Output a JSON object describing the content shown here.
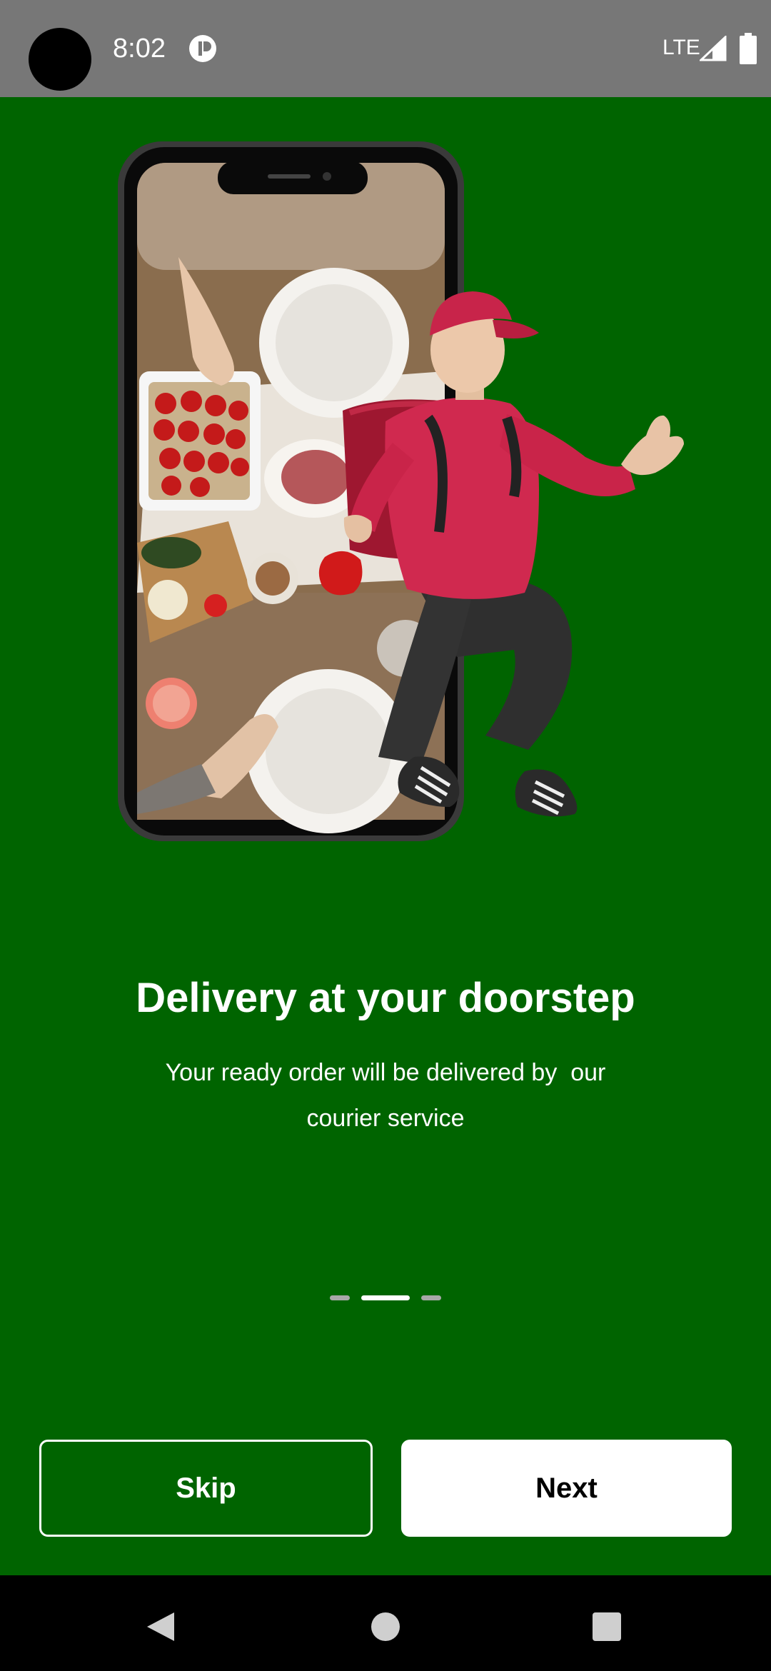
{
  "status_bar": {
    "time": "8:02",
    "network": "LTE",
    "icons": [
      "app-notification-icon",
      "signal-icon",
      "battery-icon"
    ]
  },
  "onboarding": {
    "title": "Delivery at your doorstep",
    "subtitle": "Your ready order will be delivered by  our courier service",
    "page_indicator": {
      "total": 3,
      "current": 2
    }
  },
  "buttons": {
    "skip_label": "Skip",
    "next_label": "Next"
  },
  "colors": {
    "background": "#006400",
    "status_bar": "#777777",
    "courier_shirt": "#d0294f",
    "button_text": "#000000"
  },
  "nav_bar": {
    "icons": [
      "back-icon",
      "home-icon",
      "recent-apps-icon"
    ]
  }
}
